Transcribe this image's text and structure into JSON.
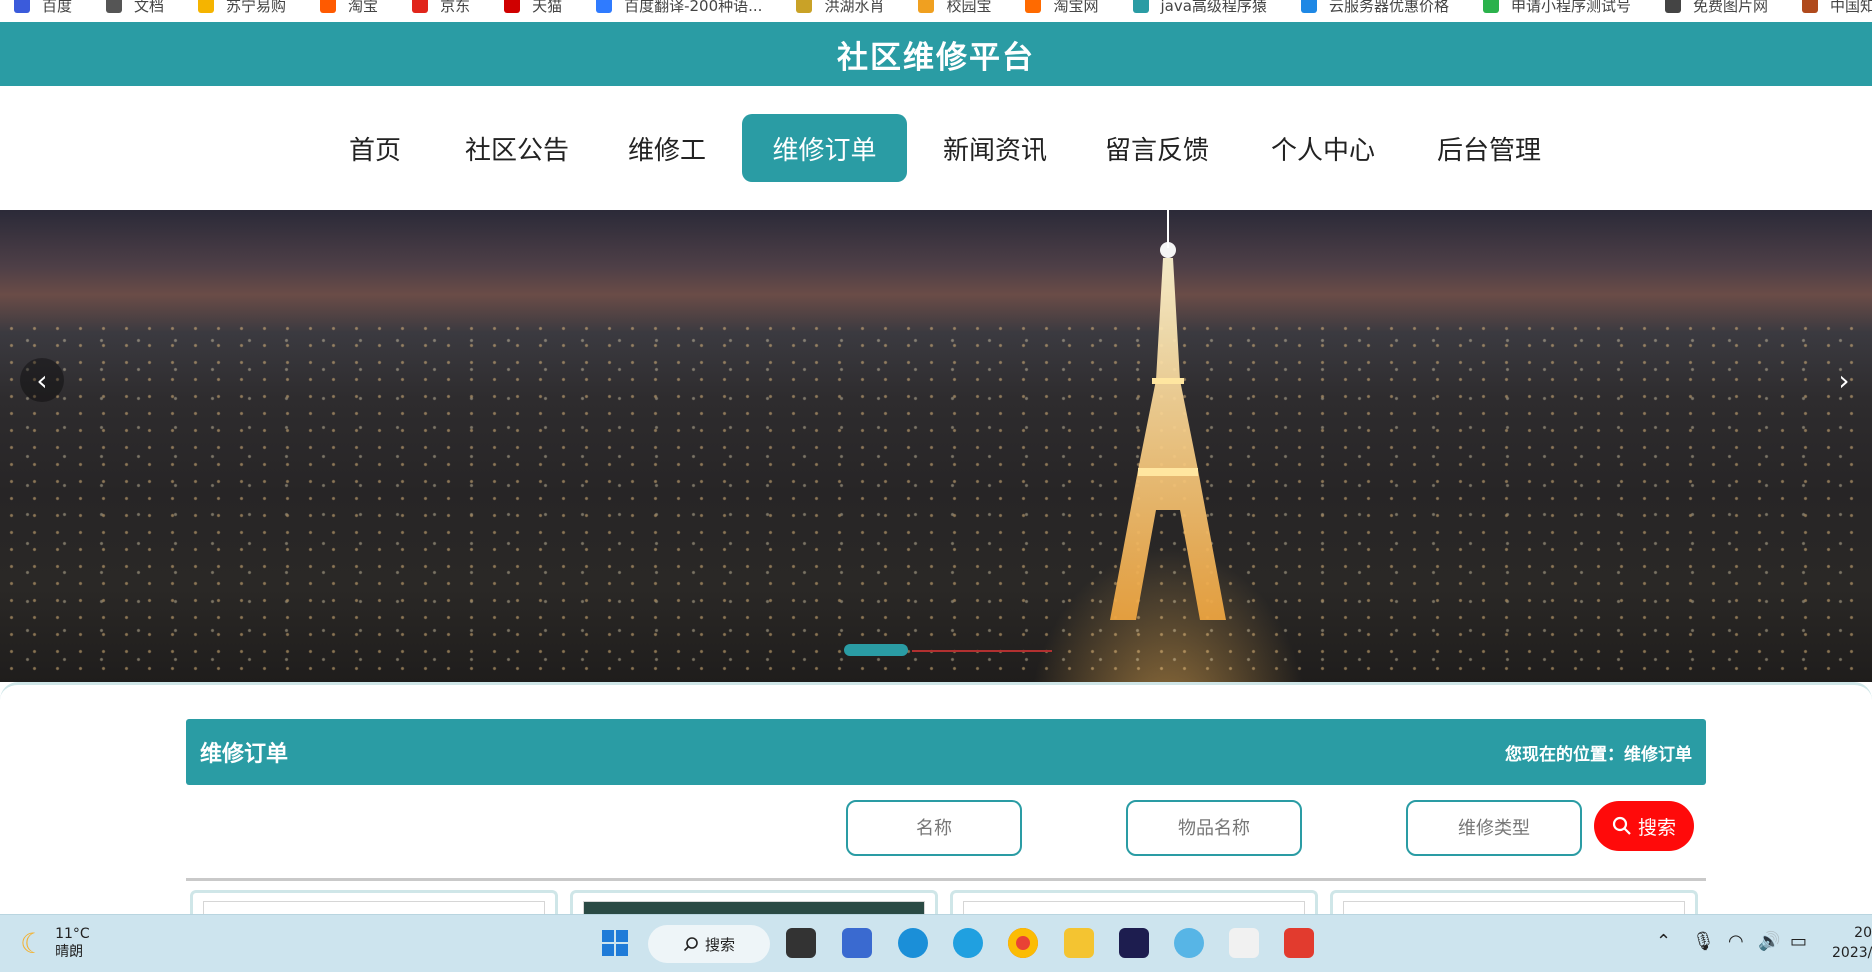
{
  "bookmarks": [
    {
      "label": "百度",
      "color": "#3b5bdb"
    },
    {
      "label": "文档",
      "color": "#555555"
    },
    {
      "label": "苏宁易购",
      "color": "#f5b400"
    },
    {
      "label": "淘宝",
      "color": "#ff5a00"
    },
    {
      "label": "京东",
      "color": "#e1251b"
    },
    {
      "label": "天猫",
      "color": "#d00000"
    },
    {
      "label": "百度翻译-200种语...",
      "color": "#2f7bff"
    },
    {
      "label": "洪湖水肖",
      "color": "#c9a227"
    },
    {
      "label": "校园宝",
      "color": "#f0a020"
    },
    {
      "label": "淘宝网",
      "color": "#ff6a00"
    },
    {
      "label": "java高级程序猿",
      "color": "#2a9ca4"
    },
    {
      "label": "云服务器优惠价格",
      "color": "#1e88e5"
    },
    {
      "label": "申请小程序测试号",
      "color": "#2bb24c"
    },
    {
      "label": "免费图片网",
      "color": "#444444"
    },
    {
      "label": "中国知网",
      "color": "#b04a1c"
    }
  ],
  "header": {
    "title": "社区维修平台"
  },
  "nav": {
    "items": [
      {
        "label": "首页"
      },
      {
        "label": "社区公告"
      },
      {
        "label": "维修工"
      },
      {
        "label": "维修订单"
      },
      {
        "label": "新闻资讯"
      },
      {
        "label": "留言反馈"
      },
      {
        "label": "个人中心"
      },
      {
        "label": "后台管理"
      }
    ],
    "active": "维修订单"
  },
  "banner": {
    "prev_icon": "chevron-left-icon",
    "next_icon": "chevron-right-icon",
    "prev_glyph": "‹",
    "next_glyph": "›"
  },
  "main": {
    "title": "维修订单",
    "location": "您现在的位置：维修订单",
    "search": {
      "name_placeholder": "名称",
      "item_placeholder": "物品名称",
      "type_placeholder": "维修类型",
      "button_label": "搜索"
    }
  },
  "taskbar": {
    "weather_temp": "11°C",
    "weather_desc": "晴朗",
    "search_label": "搜索",
    "clock_time": "20",
    "clock_date": "2023/"
  },
  "colors": {
    "accent": "#2a9ca4",
    "search_button": "#ff0a0a"
  }
}
